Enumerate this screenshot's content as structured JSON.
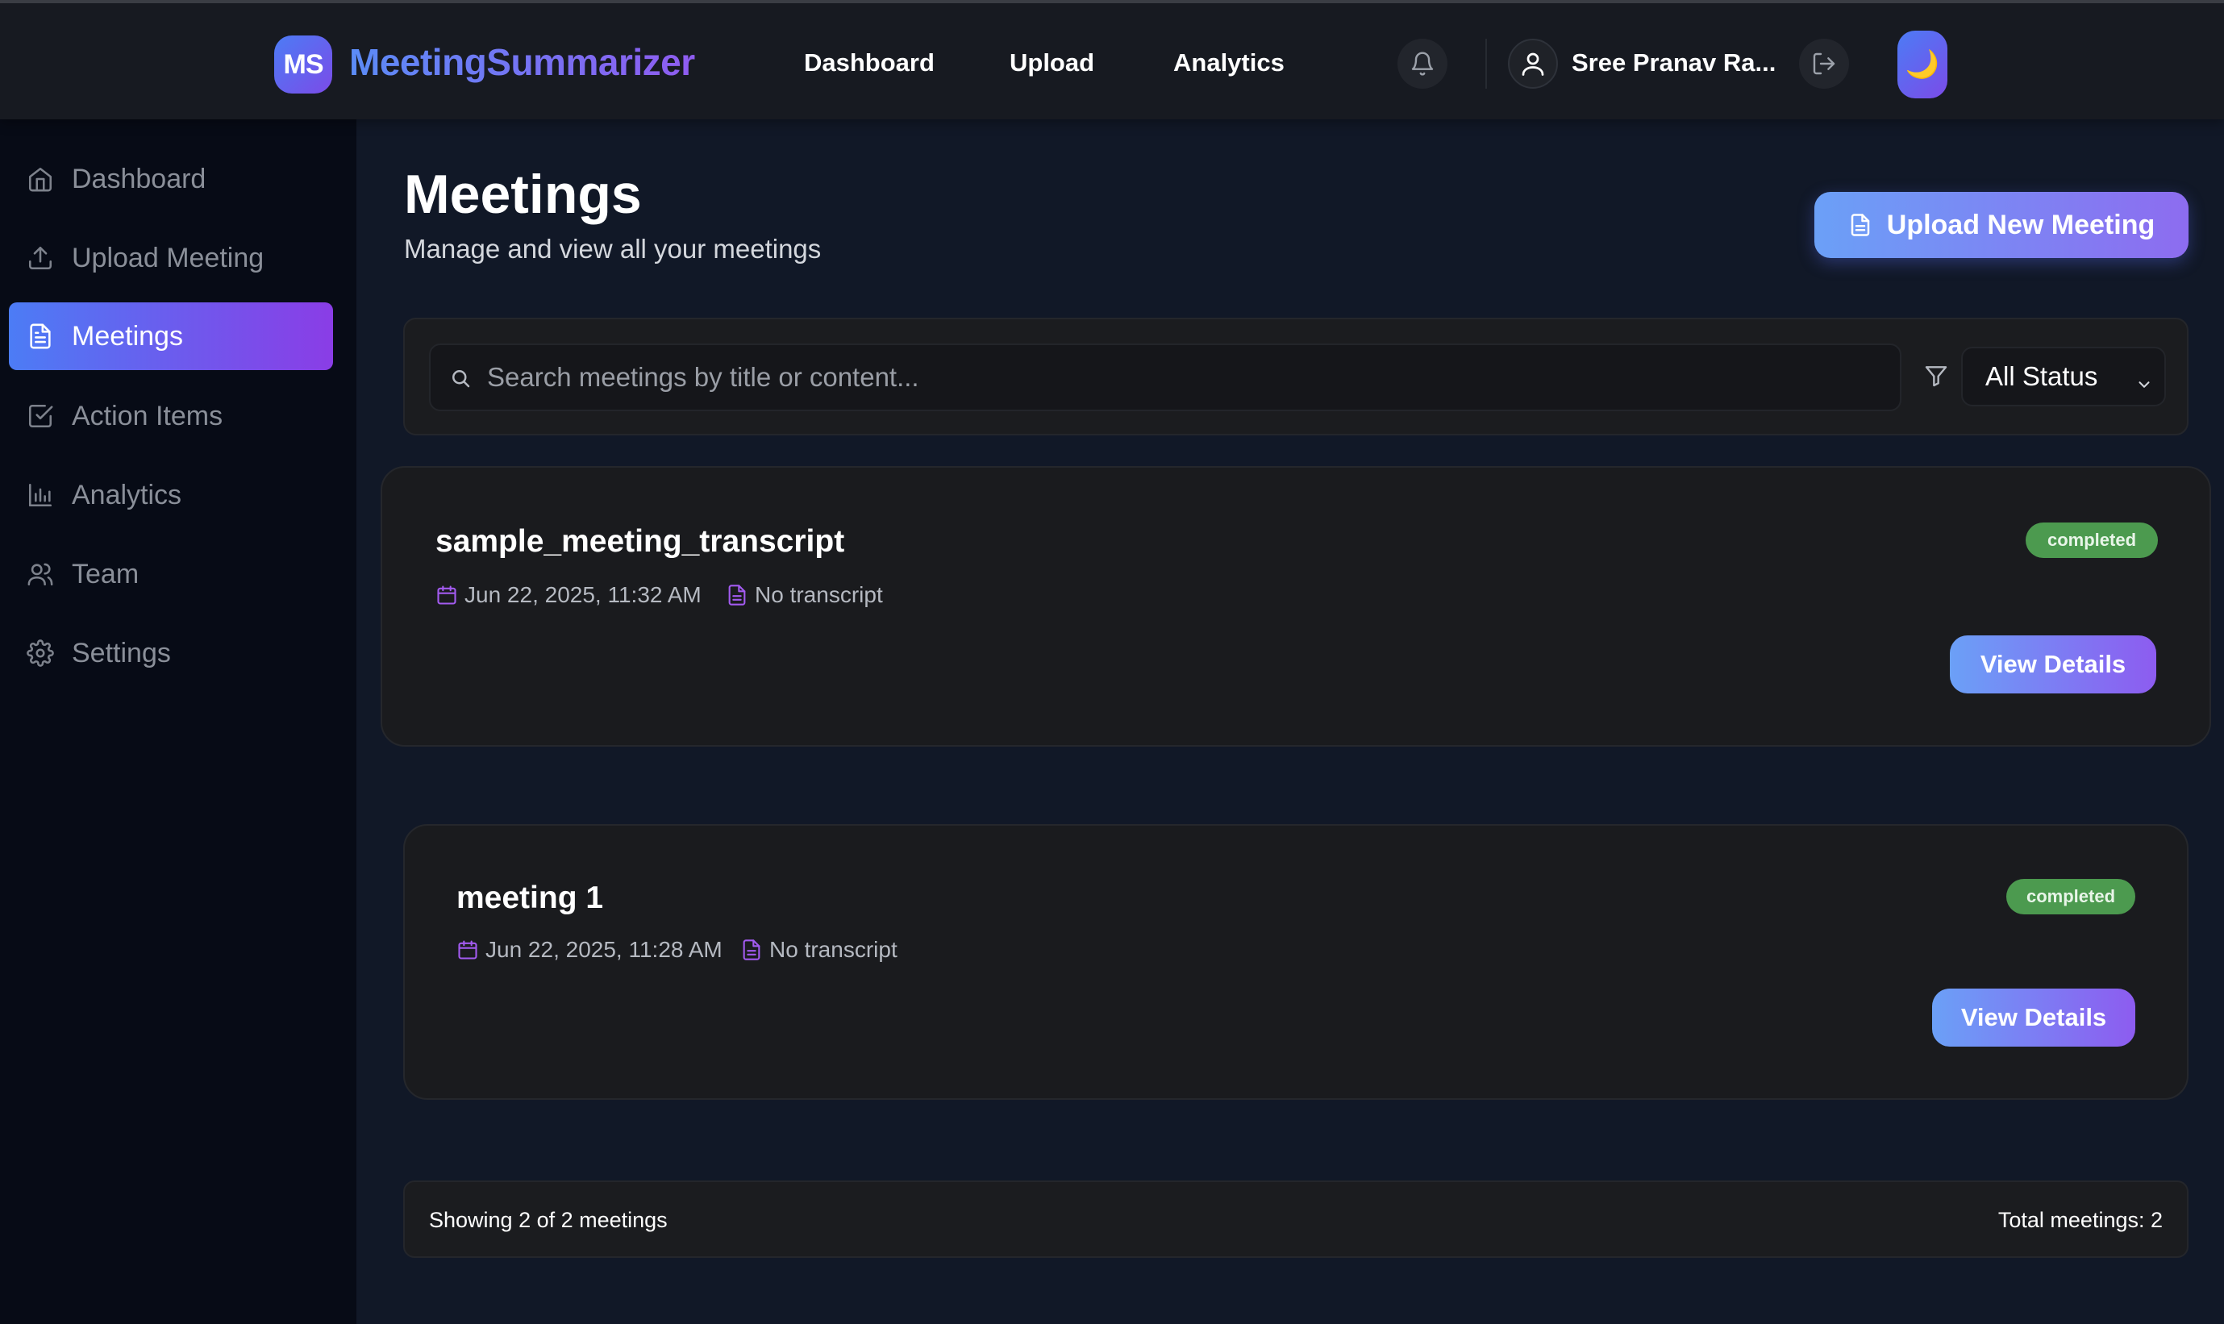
{
  "header": {
    "logo_badge": "MS",
    "app_name": "MeetingSummarizer",
    "nav": [
      {
        "label": "Dashboard"
      },
      {
        "label": "Upload"
      },
      {
        "label": "Analytics"
      }
    ],
    "user_name": "Sree Pranav Ra...",
    "icons": {
      "notifications": "bell-icon",
      "user": "user-icon",
      "logout": "logout-icon",
      "theme": "moon-icon"
    },
    "theme_glyph": "🌙"
  },
  "sidebar": {
    "items": [
      {
        "label": "Dashboard",
        "icon": "home-icon",
        "active": false
      },
      {
        "label": "Upload Meeting",
        "icon": "upload-icon",
        "active": false
      },
      {
        "label": "Meetings",
        "icon": "document-icon",
        "active": true
      },
      {
        "label": "Action Items",
        "icon": "checkbox-icon",
        "active": false
      },
      {
        "label": "Analytics",
        "icon": "bar-chart-icon",
        "active": false
      },
      {
        "label": "Team",
        "icon": "users-icon",
        "active": false
      },
      {
        "label": "Settings",
        "icon": "gear-icon",
        "active": false
      }
    ]
  },
  "main": {
    "title": "Meetings",
    "subtitle": "Manage and view all your meetings",
    "upload_button": "Upload New Meeting",
    "search": {
      "placeholder": "Search meetings by title or content...",
      "value": ""
    },
    "status_filter": {
      "selected": "All Status"
    },
    "meetings": [
      {
        "title": "sample_meeting_transcript",
        "date": "Jun 22, 2025, 11:32 AM",
        "transcript": "No transcript",
        "status": "completed",
        "action": "View Details"
      },
      {
        "title": "meeting 1",
        "date": "Jun 22, 2025, 11:28 AM",
        "transcript": "No transcript",
        "status": "completed",
        "action": "View Details"
      }
    ],
    "footer": {
      "showing": "Showing 2 of 2 meetings",
      "total": "Total meetings: 2"
    }
  },
  "colors": {
    "accent_start": "#4c7cf5",
    "accent_end": "#8a3de6",
    "status_completed": "#4c9a4f",
    "background": "#111827",
    "sidebar_bg": "#070b16"
  }
}
